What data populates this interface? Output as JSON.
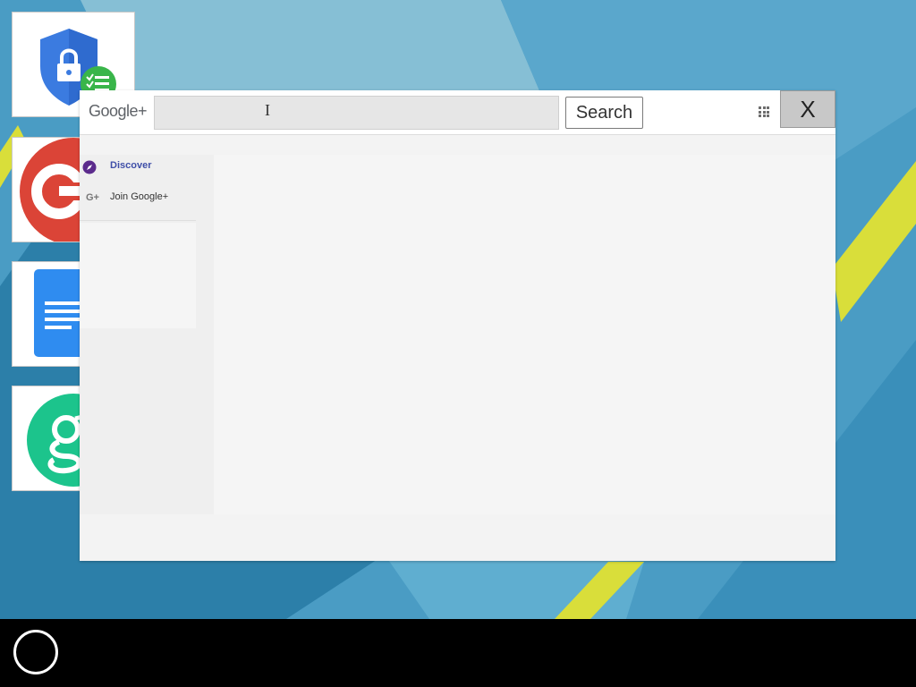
{
  "colors": {
    "wallpaper_base": "#4a9cc4",
    "wallpaper_light": "#8bc3d7",
    "wallpaper_dark": "#2a7aa4",
    "stripe_yellow": "#d9de3a",
    "taskbar": "#000000",
    "discover_accent": "#3f4fa8"
  },
  "desktop": {
    "apps": [
      {
        "icon": "security-shield-icon"
      },
      {
        "icon": "google-plus-red-icon"
      },
      {
        "icon": "docs-icon"
      },
      {
        "icon": "green-g-icon"
      }
    ]
  },
  "window": {
    "logo": "Google+",
    "search": {
      "value": "",
      "placeholder": ""
    },
    "search_button": "Search",
    "apps_icon": "apps-grid-icon",
    "close_label": "X",
    "sidebar": {
      "items": [
        {
          "label": "Discover",
          "icon": "compass-icon"
        },
        {
          "label": "Join Google+",
          "icon": "google-plus-icon"
        }
      ]
    }
  },
  "taskbar": {
    "home_icon": "circle-home-icon"
  }
}
